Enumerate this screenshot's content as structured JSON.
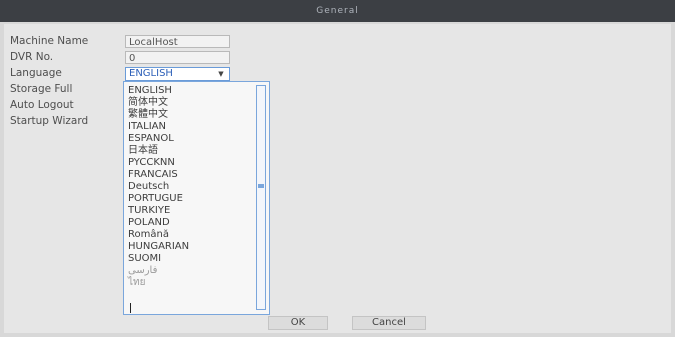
{
  "window": {
    "title": "General"
  },
  "form": {
    "labels": [
      "Machine Name",
      "DVR No.",
      "Language",
      "Storage Full",
      "Auto Logout",
      "Startup Wizard"
    ],
    "machine_name_value": "LocalHost",
    "dvr_no_value": "0",
    "language_selected": "ENGLISH"
  },
  "dropdown": {
    "options": [
      "ENGLISH",
      "简体中文",
      "繁體中文",
      "ITALIAN",
      "ESPANOL",
      "日本語",
      "PYCCKNN",
      "FRANCAIS",
      "Deutsch",
      "PORTUGUE",
      "TURKIYE",
      "POLAND",
      "Română",
      "HUNGARIAN",
      "SUOMI",
      "فارسی",
      "ไทย"
    ]
  },
  "buttons": {
    "ok": "OK",
    "cancel": "Cancel"
  },
  "colors": {
    "title_bar": "#3c3f44",
    "accent": "#6a9bd8"
  }
}
